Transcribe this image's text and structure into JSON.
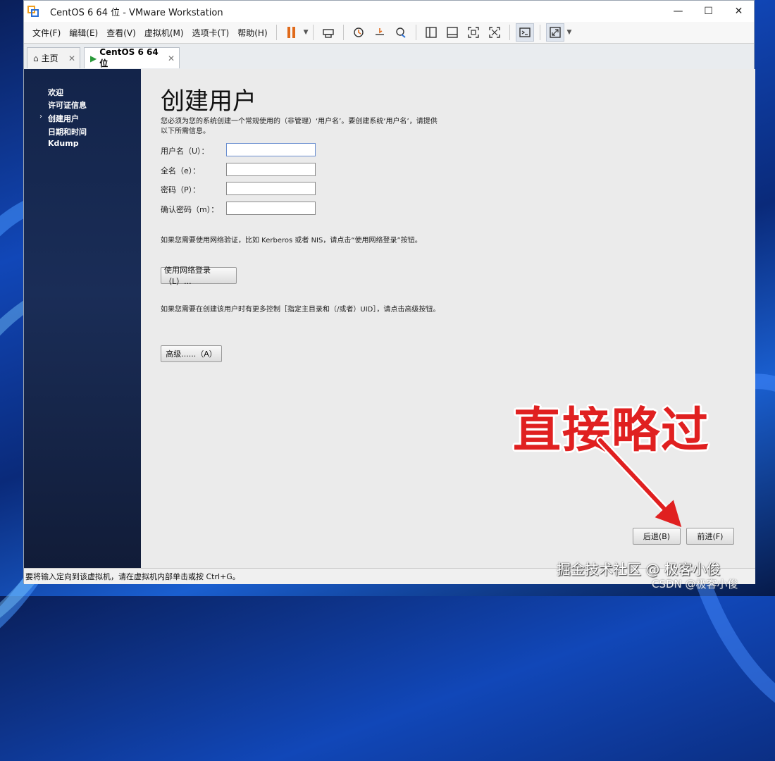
{
  "window": {
    "title": "CentOS 6 64 位 - VMware Workstation",
    "controls": {
      "minimize": "—",
      "maximize": "☐",
      "close": "✕"
    }
  },
  "menu": [
    "文件(F)",
    "编辑(E)",
    "查看(V)",
    "虚拟机(M)",
    "选项卡(T)",
    "帮助(H)"
  ],
  "tabs": [
    {
      "label": "主页",
      "icon": "home-icon"
    },
    {
      "label": "CentOS 6 64 位",
      "icon": "vm-icon"
    }
  ],
  "sidebar": {
    "items": [
      "欢迎",
      "许可证信息",
      "创建用户",
      "日期和时间",
      "Kdump"
    ],
    "current_index": 2
  },
  "page": {
    "title": "创建用户",
    "intro": "您必须为您的系统创建一个常规使用的（非管理）‘用户名’。要创建系统‘用户名’，请提供以下所需信息。",
    "fields": [
      {
        "label": "用户名（U）：",
        "value": ""
      },
      {
        "label": "全名（e）：",
        "value": ""
      },
      {
        "label": "密码（P）：",
        "value": ""
      },
      {
        "label": "确认密码（m）：",
        "value": ""
      }
    ],
    "network_note": "如果您需要使用网络验证，比如 Kerberos 或者 NIS，请点击“使用网络登录”按钮。",
    "network_button": "使用网络登录（L）...",
    "advanced_note": "如果您需要在创建该用户时有更多控制［指定主目录和（/或者）UID］，请点击高级按钮。",
    "advanced_button": "高级......（A）",
    "back_button": "后退(B)",
    "forward_button": "前进(F)"
  },
  "annotation": {
    "text": "直接略过",
    "color": "#e02020"
  },
  "status": {
    "text": "要将输入定向到该虚拟机，请在虚拟机内部单击或按 Ctrl+G。"
  },
  "watermarks": {
    "primary": "掘金技术社区 @ 极客小俊",
    "secondary": "CSDN @极客小俊"
  }
}
